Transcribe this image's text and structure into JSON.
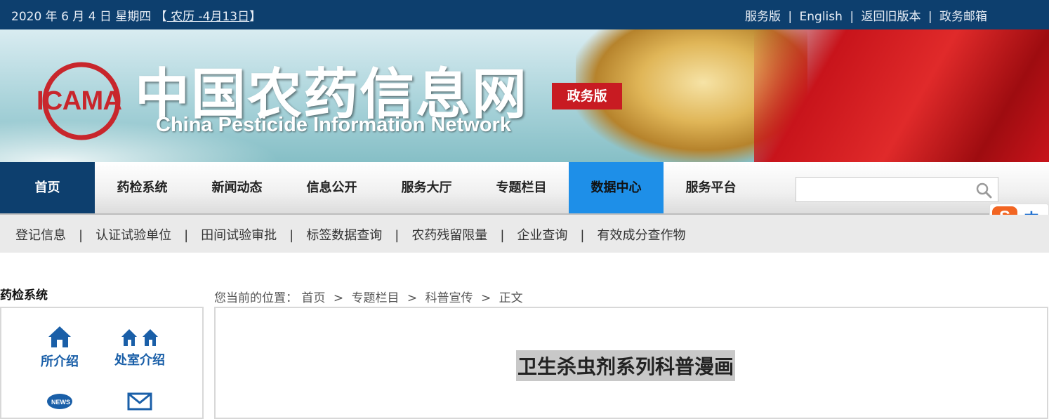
{
  "topbar": {
    "date": "2020 年 6 月 4 日 星期四",
    "lunar_open": "【",
    "lunar": " 农历 -4月13日",
    "lunar_close": "】",
    "links": [
      "服务版",
      "English",
      "返回旧版本",
      "政务邮箱"
    ],
    "separator": "|"
  },
  "banner": {
    "logo_text": "ICAMA",
    "cn_title": "中国农药信息网",
    "en_title": "China Pesticide Information Network",
    "badge": "政务版"
  },
  "nav": {
    "items": [
      "首页",
      "药检系统",
      "新闻动态",
      "信息公开",
      "服务大厅",
      "专题栏目",
      "数据中心",
      "服务平台"
    ],
    "search_placeholder": ""
  },
  "ime": {
    "logo": "S",
    "mode": "中"
  },
  "subnav": {
    "items": [
      "登记信息",
      "认证试验单位",
      "田间试验审批",
      "标签数据查询",
      "农药残留限量",
      "企业查询",
      "有效成分查作物"
    ],
    "separator": "|"
  },
  "sidebar": {
    "title": "药检系统",
    "tiles": [
      {
        "label": "所介绍",
        "icon": "home-icon"
      },
      {
        "label": "处室介绍",
        "icon": "houses-icon"
      },
      {
        "label": "",
        "icon": "news-icon"
      },
      {
        "label": "",
        "icon": "mail-icon"
      }
    ]
  },
  "breadcrumb": {
    "prefix": "您当前的位置：",
    "items": [
      "首页",
      "专题栏目",
      "科普宣传",
      "正文"
    ],
    "separator": ">"
  },
  "article": {
    "title": "卫生杀虫剂系列科普漫画"
  },
  "colors": {
    "topbar": "#0d3f6e",
    "nav_active": "#1e8fe8",
    "badge": "#c81b22",
    "tile_text": "#1a5fa8"
  }
}
